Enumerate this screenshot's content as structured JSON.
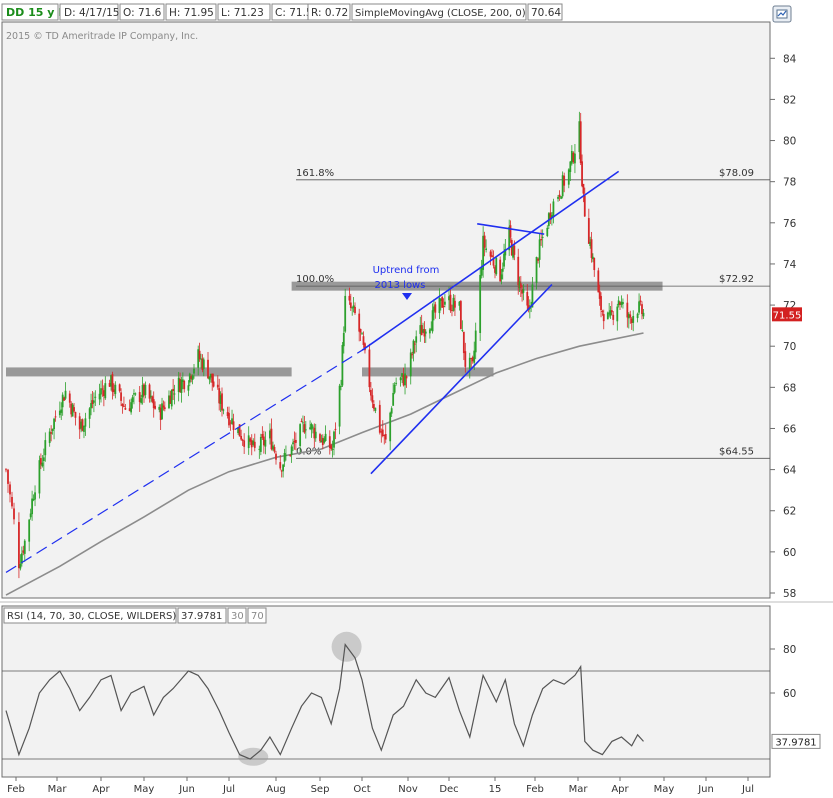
{
  "header": {
    "symbol": "DD 15 y D",
    "date": "D: 4/17/15",
    "open": "O: 71.6",
    "high": "H: 71.95",
    "low": "L: 71.23",
    "close": "C: 71.55",
    "range": "R: 0.72",
    "study": "SimpleMovingAvg (CLOSE, 200, 0)",
    "study_value": "70.64"
  },
  "copyright": "2015 © TD Ameritrade IP Company, Inc.",
  "colors": {
    "up": "#2ca02c",
    "down": "#d62728",
    "trendline": "#1f2ff0",
    "sma": "#8c8c8c",
    "price_badge": "#d32020",
    "zone": "#8a8a8a",
    "panel_bg": "#f0f0f0"
  },
  "icons": {
    "settings": "chart-settings-icon"
  },
  "chart_data": [
    {
      "type": "candlestick",
      "ylim": [
        58,
        85
      ],
      "y_ticks": [
        "84",
        "82",
        "80",
        "78",
        "76",
        "74",
        "72",
        "70",
        "68",
        "66",
        "64",
        "62",
        "60",
        "58"
      ],
      "x_ticks": [
        "Feb",
        "Mar",
        "Apr",
        "May",
        "Jun",
        "Jul",
        "Aug",
        "Sep",
        "Oct",
        "Nov",
        "Dec",
        "15",
        "Feb",
        "Mar",
        "Apr",
        "May",
        "Jun",
        "Jul"
      ],
      "last_price": {
        "label": "71.55",
        "value": 71.55
      },
      "price_path": [
        [
          "2014-01-27",
          64.0
        ],
        [
          "2014-02-03",
          59.5
        ],
        [
          "2014-02-07",
          60.5
        ],
        [
          "2014-02-14",
          63.3
        ],
        [
          "2014-02-24",
          65.8
        ],
        [
          "2014-03-03",
          67.2
        ],
        [
          "2014-03-07",
          67.8
        ],
        [
          "2014-03-17",
          66.0
        ],
        [
          "2014-03-28",
          67.5
        ],
        [
          "2014-04-07",
          68.3
        ],
        [
          "2014-04-18",
          67.0
        ],
        [
          "2014-05-01",
          67.8
        ],
        [
          "2014-05-12",
          66.7
        ],
        [
          "2014-05-23",
          68.0
        ],
        [
          "2014-06-02",
          68.5
        ],
        [
          "2014-06-09",
          69.5
        ],
        [
          "2014-06-16",
          68.8
        ],
        [
          "2014-06-24",
          67.4
        ],
        [
          "2014-07-08",
          65.8
        ],
        [
          "2014-07-18",
          64.9
        ],
        [
          "2014-07-28",
          65.6
        ],
        [
          "2014-08-04",
          64.2
        ],
        [
          "2014-08-12",
          65.0
        ],
        [
          "2014-08-22",
          66.3
        ],
        [
          "2014-09-02",
          65.5
        ],
        [
          "2014-09-10",
          65.0
        ],
        [
          "2014-09-16",
          68.5
        ],
        [
          "2014-09-19",
          72.2
        ],
        [
          "2014-09-26",
          71.5
        ],
        [
          "2014-10-01",
          70.2
        ],
        [
          "2014-10-07",
          67.8
        ],
        [
          "2014-10-13",
          66.0
        ],
        [
          "2014-10-17",
          65.3
        ],
        [
          "2014-10-23",
          68.2
        ],
        [
          "2014-10-31",
          68.5
        ],
        [
          "2014-11-07",
          70.5
        ],
        [
          "2014-11-17",
          71.2
        ],
        [
          "2014-11-28",
          72.3
        ],
        [
          "2014-12-08",
          71.8
        ],
        [
          "2014-12-12",
          69.2
        ],
        [
          "2014-12-17",
          68.9
        ],
        [
          "2014-12-24",
          75.0
        ],
        [
          "2015-01-05",
          73.5
        ],
        [
          "2015-01-12",
          75.4
        ],
        [
          "2015-01-20",
          73.0
        ],
        [
          "2015-01-27",
          71.5
        ],
        [
          "2015-02-03",
          74.5
        ],
        [
          "2015-02-12",
          76.8
        ],
        [
          "2015-02-23",
          78.5
        ],
        [
          "2015-03-02",
          80.5
        ],
        [
          "2015-03-05",
          77.0
        ],
        [
          "2015-03-10",
          75.0
        ],
        [
          "2015-03-17",
          72.0
        ],
        [
          "2015-03-24",
          71.2
        ],
        [
          "2015-03-31",
          72.3
        ],
        [
          "2015-04-07",
          71.3
        ],
        [
          "2015-04-13",
          71.9
        ],
        [
          "2015-04-17",
          71.55
        ]
      ],
      "sma_200": [
        [
          "2014-01-27",
          57.9
        ],
        [
          "2014-03-03",
          59.3
        ],
        [
          "2014-04-01",
          60.5
        ],
        [
          "2014-05-01",
          61.7
        ],
        [
          "2014-06-02",
          63.0
        ],
        [
          "2014-07-01",
          63.9
        ],
        [
          "2014-08-01",
          64.6
        ],
        [
          "2014-09-02",
          65.0
        ],
        [
          "2014-10-01",
          65.8
        ],
        [
          "2014-11-03",
          66.7
        ],
        [
          "2014-12-01",
          67.6
        ],
        [
          "2015-01-02",
          68.7
        ],
        [
          "2015-02-02",
          69.4
        ],
        [
          "2015-03-02",
          70.0
        ],
        [
          "2015-04-17",
          70.64
        ]
      ],
      "fib_levels": [
        {
          "label": "161.8%",
          "value": 78.09,
          "price_label": "$78.09"
        },
        {
          "label": "100.0%",
          "value": 72.92,
          "price_label": "$72.92"
        },
        {
          "label": "0.0%",
          "value": 64.55,
          "price_label": "$64.55"
        }
      ],
      "zones": [
        {
          "from": "2014-01-27",
          "to": "2014-08-12",
          "value": 68.75
        },
        {
          "from": "2014-10-01",
          "to": "2014-12-31",
          "value": 68.75
        },
        {
          "from": "2014-08-12",
          "to": "2015-04-30",
          "value": 72.92
        }
      ],
      "trendlines": [
        {
          "style": "dashed",
          "points": [
            [
              "2014-01-27",
              59.0
            ],
            [
              "2014-10-01",
              69.8
            ]
          ]
        },
        {
          "style": "solid",
          "points": [
            [
              "2014-10-01",
              69.8
            ],
            [
              "2015-03-31",
              78.5
            ]
          ]
        },
        {
          "style": "solid",
          "points": [
            [
              "2014-10-07",
              63.8
            ],
            [
              "2015-02-12",
              73.0
            ]
          ]
        },
        {
          "style": "solid",
          "points": [
            [
              "2014-12-20",
              75.95
            ],
            [
              "2015-02-07",
              75.45
            ]
          ]
        }
      ],
      "annotation": {
        "text": "Uptrend from 2013 lows"
      }
    },
    {
      "type": "line",
      "title": "RSI (14, 70, 30, CLOSE, WILDERS)",
      "value_label": "37.9781",
      "thresholds": [
        "30",
        "70"
      ],
      "ylim": [
        28,
        90
      ],
      "y_ticks": [
        "80",
        "60"
      ],
      "reference_lines": [
        30,
        70
      ],
      "series": [
        [
          "2014-01-27",
          52
        ],
        [
          "2014-02-03",
          32
        ],
        [
          "2014-02-10",
          44
        ],
        [
          "2014-02-17",
          60
        ],
        [
          "2014-02-24",
          66
        ],
        [
          "2014-03-03",
          70
        ],
        [
          "2014-03-10",
          62
        ],
        [
          "2014-03-17",
          52
        ],
        [
          "2014-03-24",
          58
        ],
        [
          "2014-04-01",
          66
        ],
        [
          "2014-04-08",
          68
        ],
        [
          "2014-04-15",
          52
        ],
        [
          "2014-04-22",
          60
        ],
        [
          "2014-05-01",
          63
        ],
        [
          "2014-05-08",
          50
        ],
        [
          "2014-05-15",
          58
        ],
        [
          "2014-05-22",
          62
        ],
        [
          "2014-06-02",
          70
        ],
        [
          "2014-06-09",
          68
        ],
        [
          "2014-06-16",
          62
        ],
        [
          "2014-06-24",
          52
        ],
        [
          "2014-07-01",
          42
        ],
        [
          "2014-07-08",
          32
        ],
        [
          "2014-07-15",
          30
        ],
        [
          "2014-07-22",
          34
        ],
        [
          "2014-07-28",
          40
        ],
        [
          "2014-08-04",
          32
        ],
        [
          "2014-08-12",
          44
        ],
        [
          "2014-08-19",
          54
        ],
        [
          "2014-08-26",
          60
        ],
        [
          "2014-09-02",
          58
        ],
        [
          "2014-09-09",
          46
        ],
        [
          "2014-09-15",
          62
        ],
        [
          "2014-09-19",
          82
        ],
        [
          "2014-09-26",
          76
        ],
        [
          "2014-10-01",
          66
        ],
        [
          "2014-10-08",
          44
        ],
        [
          "2014-10-14",
          34
        ],
        [
          "2014-10-22",
          50
        ],
        [
          "2014-10-29",
          54
        ],
        [
          "2014-11-07",
          66
        ],
        [
          "2014-11-14",
          60
        ],
        [
          "2014-11-21",
          58
        ],
        [
          "2014-12-01",
          67
        ],
        [
          "2014-12-08",
          52
        ],
        [
          "2014-12-15",
          40
        ],
        [
          "2014-12-24",
          68
        ],
        [
          "2015-01-02",
          56
        ],
        [
          "2015-01-09",
          66
        ],
        [
          "2015-01-16",
          46
        ],
        [
          "2015-01-23",
          36
        ],
        [
          "2015-01-30",
          50
        ],
        [
          "2015-02-06",
          62
        ],
        [
          "2015-02-13",
          66
        ],
        [
          "2015-02-20",
          64
        ],
        [
          "2015-02-27",
          68
        ],
        [
          "2015-03-03",
          72
        ],
        [
          "2015-03-06",
          38
        ],
        [
          "2015-03-12",
          34
        ],
        [
          "2015-03-19",
          32
        ],
        [
          "2015-03-26",
          38
        ],
        [
          "2015-04-02",
          40
        ],
        [
          "2015-04-09",
          36
        ],
        [
          "2015-04-13",
          41
        ],
        [
          "2015-04-17",
          38
        ]
      ]
    }
  ]
}
